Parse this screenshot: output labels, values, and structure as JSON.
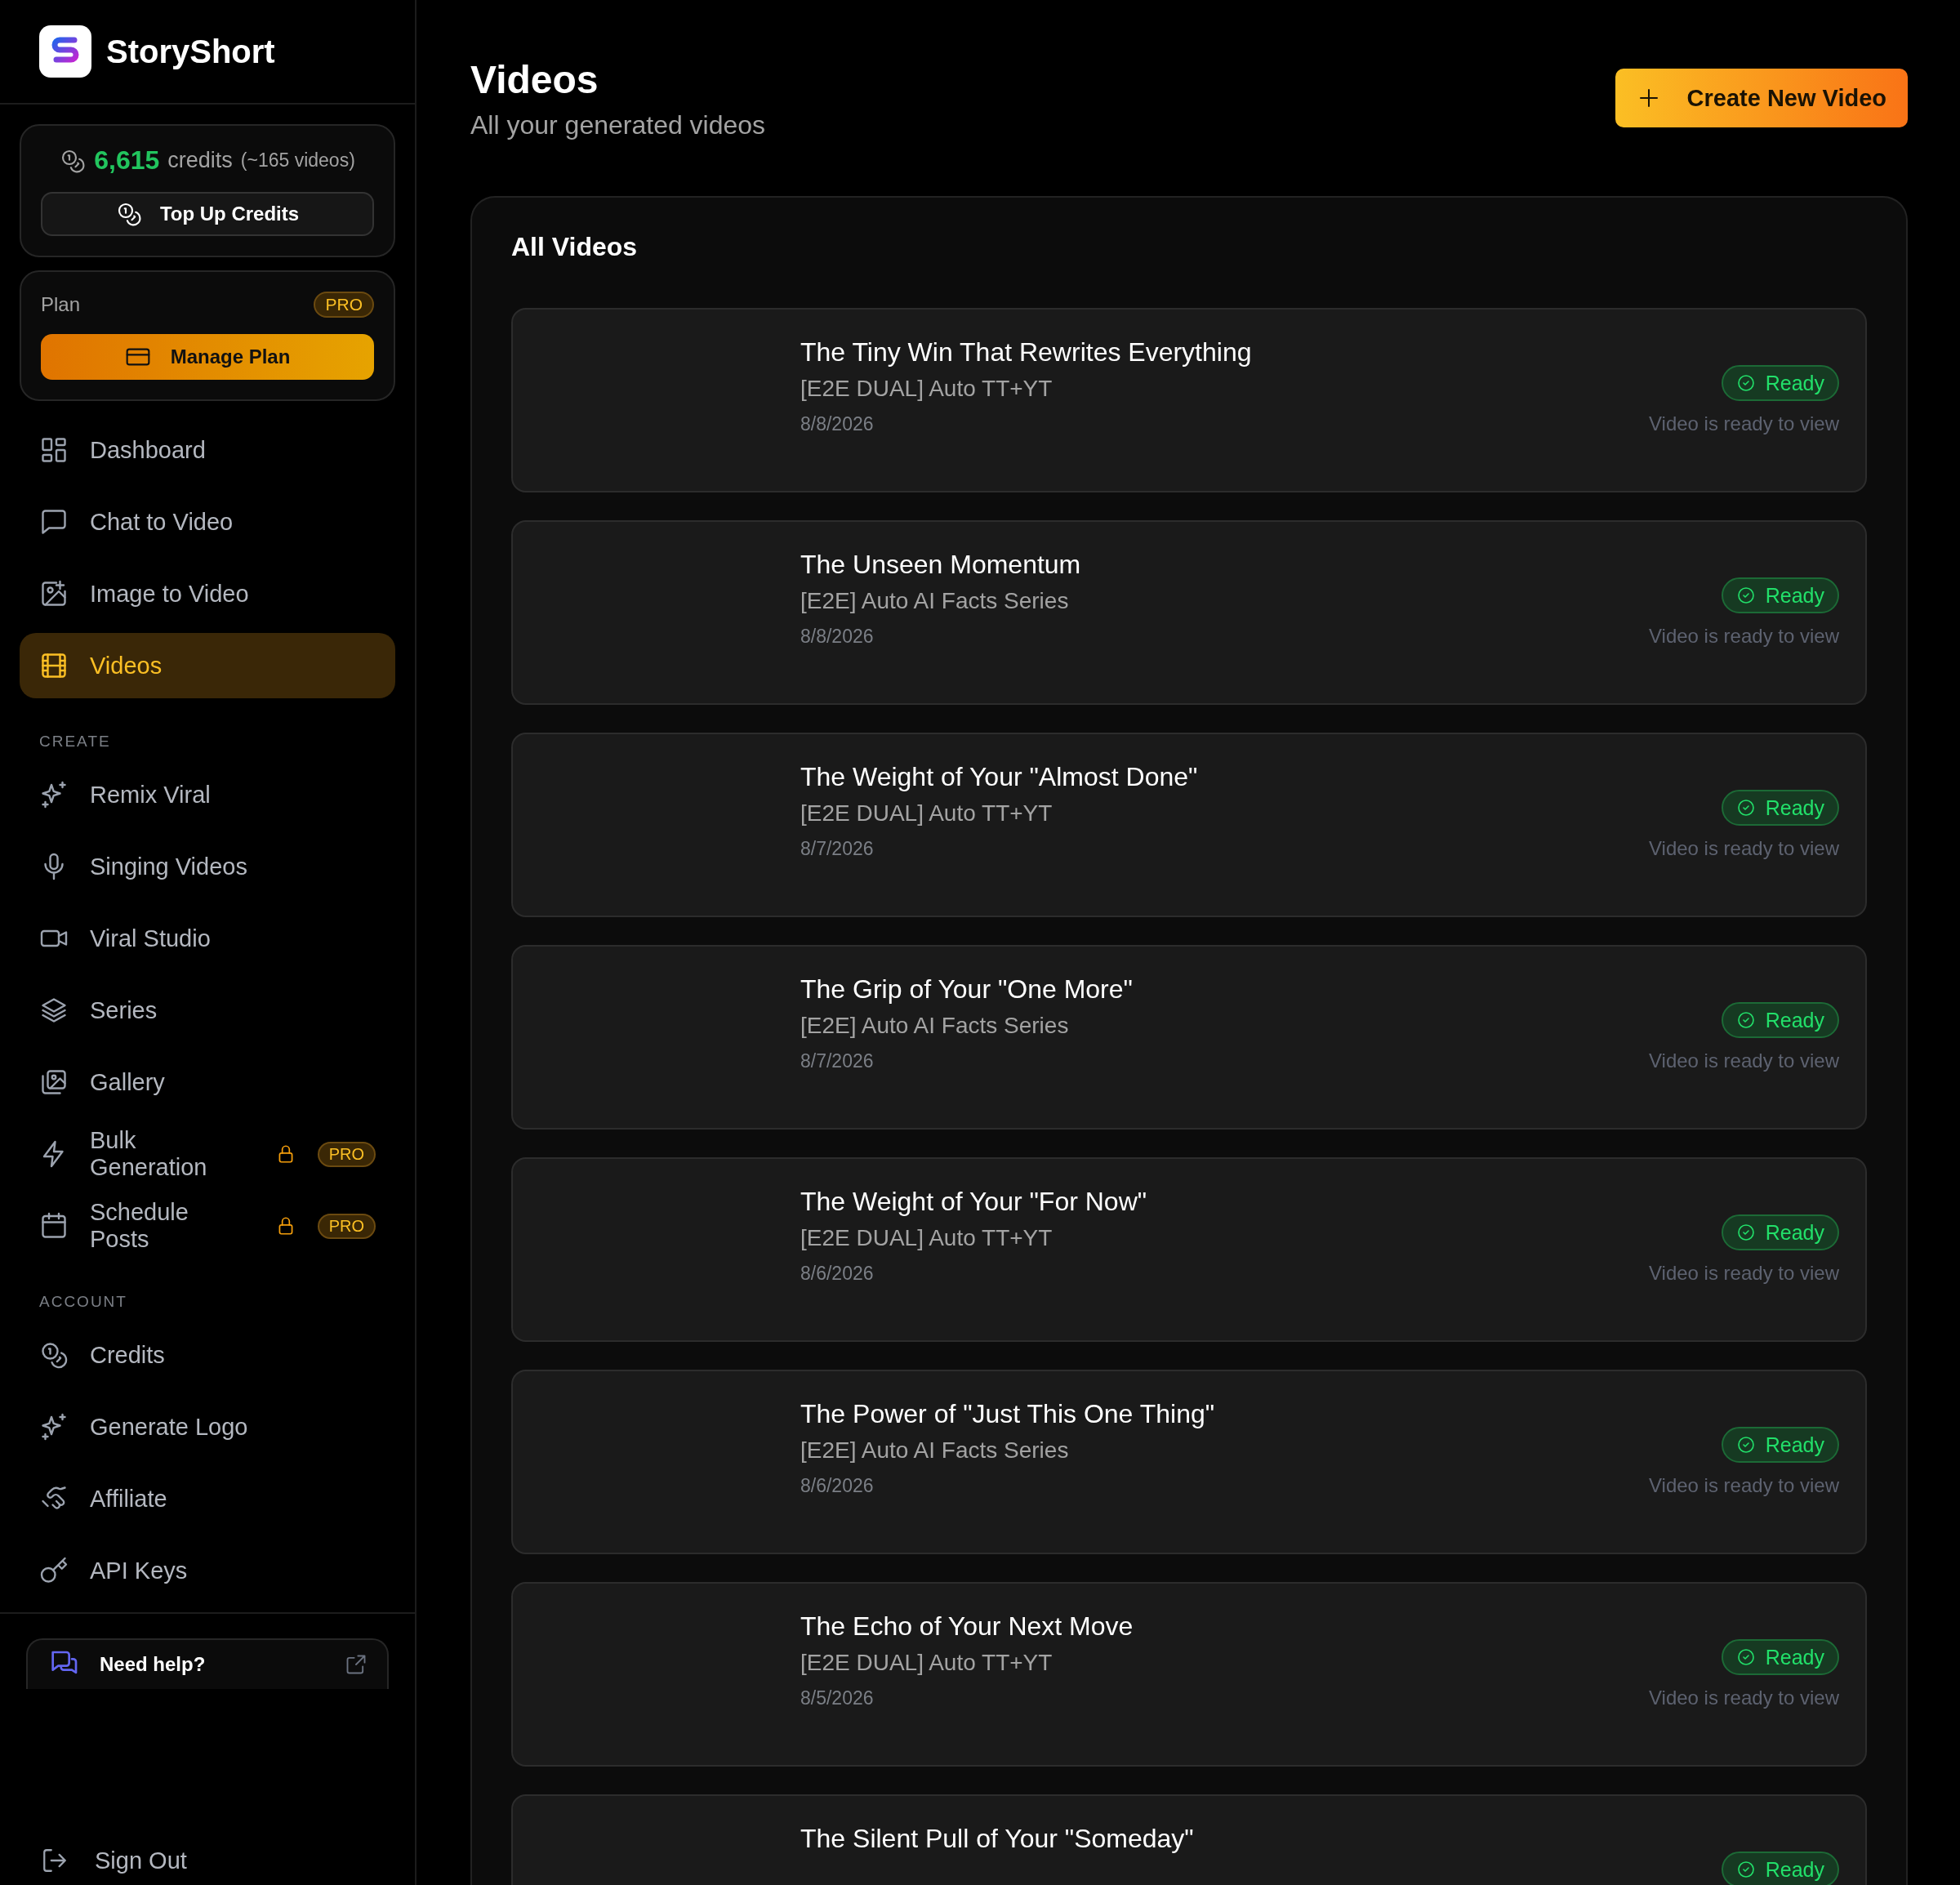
{
  "sidebar": {
    "brand": "StoryShort",
    "credits": {
      "amount": "6,615",
      "unit": "credits",
      "estimate": "(~165 videos)",
      "button": "Top Up Credits"
    },
    "plan": {
      "label": "Plan",
      "badge": "PRO",
      "button": "Manage Plan"
    },
    "nav": [
      {
        "label": "Dashboard",
        "selected": false
      },
      {
        "label": "Chat to Video",
        "selected": false
      },
      {
        "label": "Image to Video",
        "selected": false
      },
      {
        "label": "Videos",
        "selected": true
      }
    ],
    "sections": [
      {
        "heading": "CREATE",
        "items": [
          {
            "label": "Remix Viral",
            "locked": false
          },
          {
            "label": "Singing Videos",
            "locked": false
          },
          {
            "label": "Viral Studio",
            "locked": false
          },
          {
            "label": "Series",
            "locked": false
          },
          {
            "label": "Gallery",
            "locked": false
          },
          {
            "label": "Bulk Generation",
            "locked": true,
            "badge": "PRO"
          },
          {
            "label": "Schedule Posts",
            "locked": true,
            "badge": "PRO"
          }
        ]
      },
      {
        "heading": "ACCOUNT",
        "items": [
          {
            "label": "Credits",
            "locked": false
          },
          {
            "label": "Generate Logo",
            "locked": false
          },
          {
            "label": "Affiliate",
            "locked": false
          },
          {
            "label": "API Keys",
            "locked": false
          }
        ]
      }
    ],
    "help": {
      "title": "Need help?"
    },
    "sign_out": "Sign Out"
  },
  "header": {
    "title": "Videos",
    "subtitle": "All your generated videos",
    "create_button": "Create New Video"
  },
  "panel": {
    "title": "All Videos",
    "videos": [
      {
        "title": "The Tiny Win That Rewrites Everything",
        "series": "[E2E DUAL] Auto TT+YT",
        "date": "8/8/2026",
        "status": {
          "kind": "ready",
          "label": "Ready"
        },
        "note": "Video is ready to view"
      },
      {
        "title": "The Unseen Momentum",
        "series": "[E2E] Auto AI Facts Series",
        "date": "8/8/2026",
        "status": {
          "kind": "ready",
          "label": "Ready"
        },
        "note": "Video is ready to view"
      },
      {
        "title": "The Weight of Your \"Almost Done\"",
        "series": "[E2E DUAL] Auto TT+YT",
        "date": "8/7/2026",
        "status": {
          "kind": "ready",
          "label": "Ready"
        },
        "note": "Video is ready to view"
      },
      {
        "title": "The Grip of Your \"One More\"",
        "series": "[E2E] Auto AI Facts Series",
        "date": "8/7/2026",
        "status": {
          "kind": "ready",
          "label": "Ready"
        },
        "note": "Video is ready to view"
      },
      {
        "title": "The Weight of Your \"For Now\"",
        "series": "[E2E DUAL] Auto TT+YT",
        "date": "8/6/2026",
        "status": {
          "kind": "ready",
          "label": "Ready"
        },
        "note": "Video is ready to view"
      },
      {
        "title": "The Power of \"Just This One Thing\"",
        "series": "[E2E] Auto AI Facts Series",
        "date": "8/6/2026",
        "status": {
          "kind": "ready",
          "label": "Ready"
        },
        "note": "Video is ready to view"
      },
      {
        "title": "The Echo of Your Next Move",
        "series": "[E2E DUAL] Auto TT+YT",
        "date": "8/5/2026",
        "status": {
          "kind": "ready",
          "label": "Ready"
        },
        "note": "Video is ready to view"
      },
      {
        "title": "The Silent Pull of Your \"Someday\"",
        "status": {
          "kind": "ready",
          "label": "Ready"
        }
      }
    ]
  }
}
